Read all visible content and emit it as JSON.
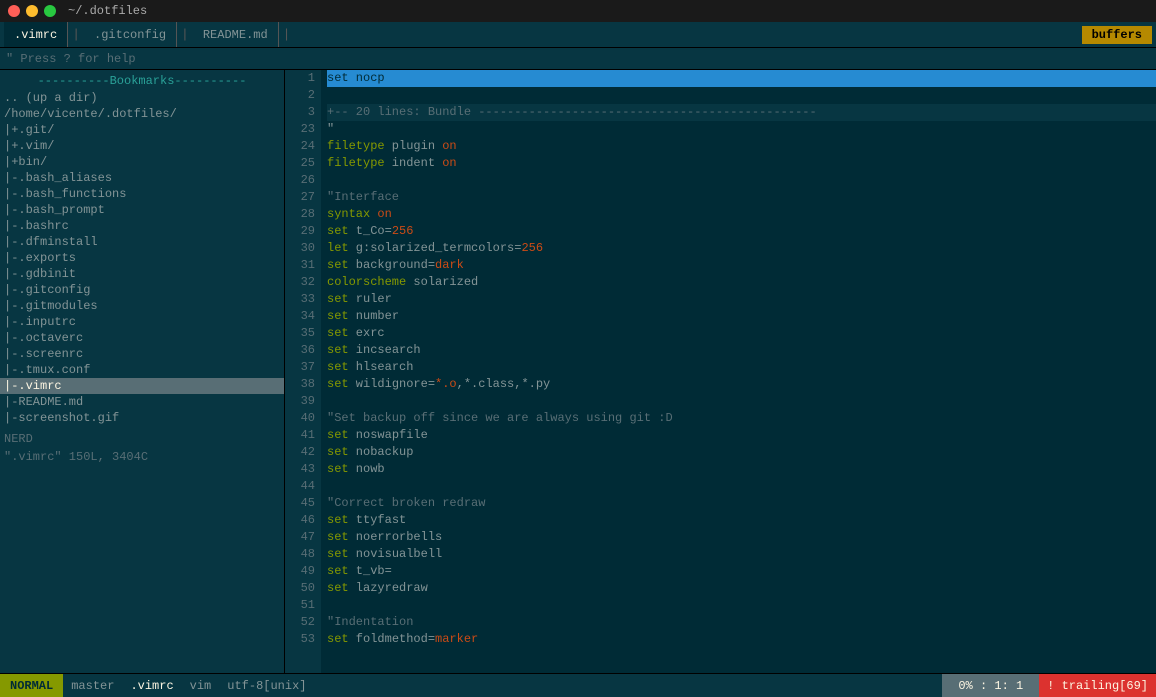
{
  "titlebar": {
    "title": "~/.dotfiles"
  },
  "tabs": [
    {
      "id": "vimrc",
      "label": ".vimrc",
      "active": true
    },
    {
      "id": "gitconfig",
      "label": ".gitconfig",
      "active": false
    },
    {
      "id": "readme",
      "label": "README.md",
      "active": false
    }
  ],
  "buffers_btn": "buffers",
  "helpline": {
    "text": "\" Press ? for help"
  },
  "sidebar": {
    "bookmarks_label": "----------Bookmarks----------",
    "items": [
      {
        "label": ".. (up a dir)",
        "type": "nav"
      },
      {
        "label": "/home/vicente/.dotfiles/",
        "type": "path"
      },
      {
        "label": "|+.git/",
        "type": "dir"
      },
      {
        "label": "|+.vim/",
        "type": "dir"
      },
      {
        "label": "|+bin/",
        "type": "dir"
      },
      {
        "label": "|-.bash_aliases",
        "type": "file"
      },
      {
        "label": "|-.bash_functions",
        "type": "file"
      },
      {
        "label": "|-.bash_prompt",
        "type": "file"
      },
      {
        "label": "|-.bashrc",
        "type": "file"
      },
      {
        "label": "|-.dfminstall",
        "type": "file"
      },
      {
        "label": "|-.exports",
        "type": "file"
      },
      {
        "label": "|-.gdbinit",
        "type": "file"
      },
      {
        "label": "|-.gitconfig",
        "type": "file"
      },
      {
        "label": "|-.gitmodules",
        "type": "file"
      },
      {
        "label": "|-.inputrc",
        "type": "file"
      },
      {
        "label": "|-.octaverc",
        "type": "file"
      },
      {
        "label": "|-.screenrc",
        "type": "file"
      },
      {
        "label": "|-.tmux.conf",
        "type": "file"
      },
      {
        "label": "|-.vimrc",
        "type": "active"
      },
      {
        "label": "|-README.md",
        "type": "file"
      },
      {
        "label": "|-screenshot.gif",
        "type": "file"
      }
    ],
    "nerd_label": "NERD"
  },
  "editor": {
    "lines": [
      {
        "num": 1,
        "text": "set nocp",
        "style": "first"
      },
      {
        "num": 2,
        "text": ""
      },
      {
        "num": 3,
        "text": "+-- 20 lines: Bundle -----------------------------------------------",
        "style": "folded"
      },
      {
        "num": 23,
        "text": "\""
      },
      {
        "num": 24,
        "text": "filetype plugin on"
      },
      {
        "num": 25,
        "text": "filetype indent on"
      },
      {
        "num": 26,
        "text": ""
      },
      {
        "num": 27,
        "text": "\"Interface",
        "style": "comment"
      },
      {
        "num": 28,
        "text": "syntax on"
      },
      {
        "num": 29,
        "text": "set t_Co=256"
      },
      {
        "num": 30,
        "text": "let g:solarized_termcolors=256"
      },
      {
        "num": 31,
        "text": "set background=dark"
      },
      {
        "num": 32,
        "text": "colorscheme solarized"
      },
      {
        "num": 33,
        "text": "set ruler"
      },
      {
        "num": 34,
        "text": "set number"
      },
      {
        "num": 35,
        "text": "set exrc"
      },
      {
        "num": 36,
        "text": "set incsearch"
      },
      {
        "num": 37,
        "text": "set hlsearch"
      },
      {
        "num": 38,
        "text": "set wildignore=*.o,*.class,*.py"
      },
      {
        "num": 39,
        "text": ""
      },
      {
        "num": 40,
        "text": "\"Set backup off since we are always using git :D",
        "style": "comment"
      },
      {
        "num": 41,
        "text": "set noswapfile"
      },
      {
        "num": 42,
        "text": "set nobackup"
      },
      {
        "num": 43,
        "text": "set nowb"
      },
      {
        "num": 44,
        "text": ""
      },
      {
        "num": 45,
        "text": "\"Correct broken redraw",
        "style": "comment"
      },
      {
        "num": 46,
        "text": "set ttyfast"
      },
      {
        "num": 47,
        "text": "set noerrorbells"
      },
      {
        "num": 48,
        "text": "set novisualbell"
      },
      {
        "num": 49,
        "text": "set t_vb="
      },
      {
        "num": 50,
        "text": "set lazyredraw"
      },
      {
        "num": 51,
        "text": ""
      },
      {
        "num": 52,
        "text": "\"Indentation",
        "style": "comment"
      },
      {
        "num": 53,
        "text": "set foldmethod=marker"
      }
    ]
  },
  "statusbar": {
    "mode": "NORMAL",
    "branch": "master",
    "file": ".vimrc",
    "vim_label": "vim",
    "encoding": "utf-8[unix]",
    "position": "0%  :  1:  1",
    "trailing": "! trailing[69]"
  },
  "fileinfo": {
    "text": "\".vimrc\" 150L, 3404C"
  }
}
